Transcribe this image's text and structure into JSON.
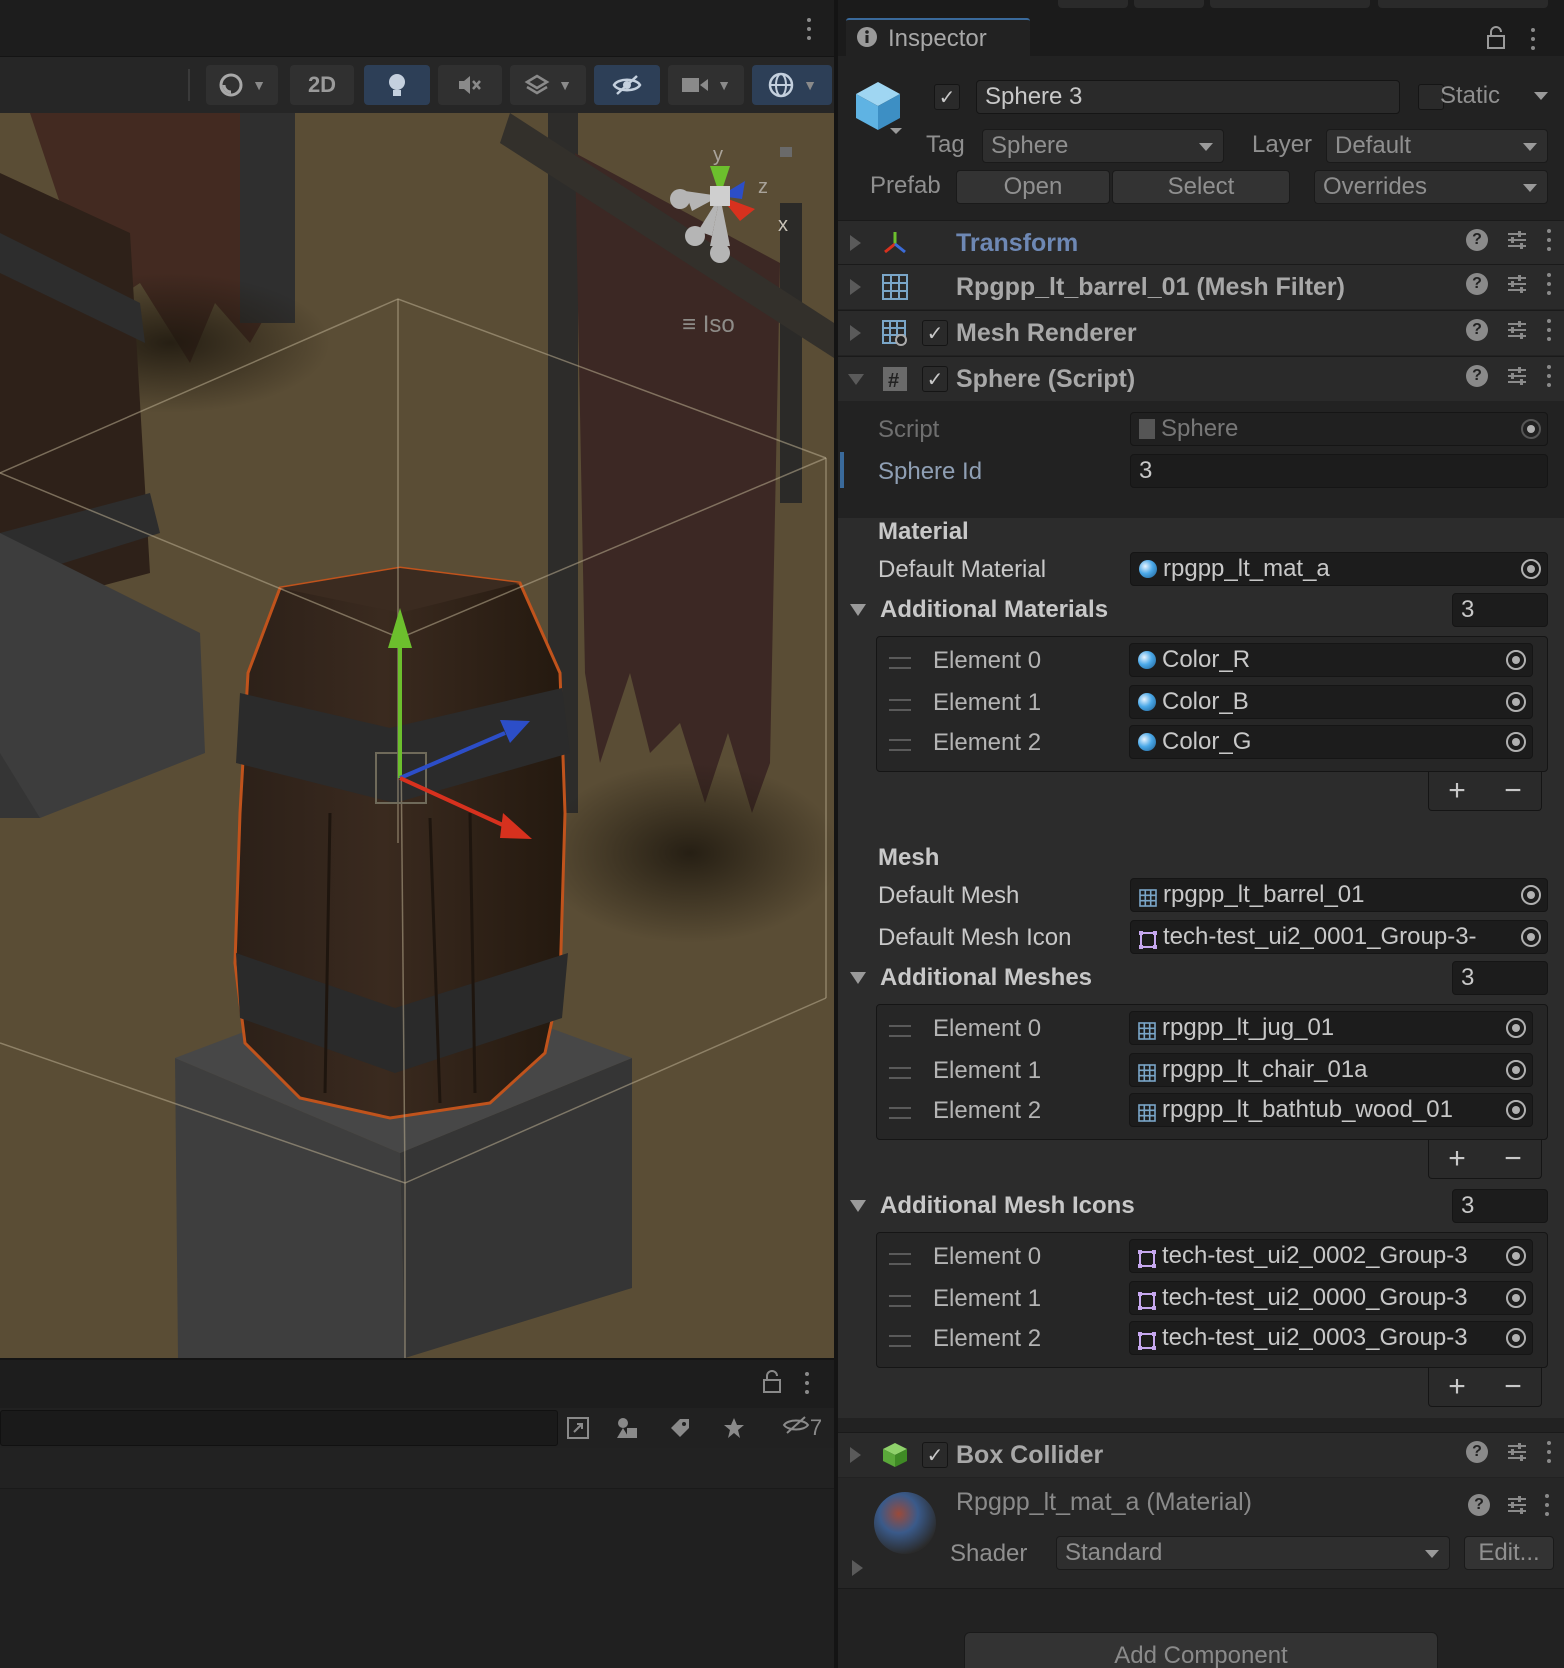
{
  "scene": {
    "toolbar": {
      "mode_2d": "2D"
    },
    "gizmo": {
      "x": "x",
      "y": "y",
      "z": "z"
    },
    "projection": "Iso",
    "bottom": {
      "hidden_count": "7"
    }
  },
  "inspector": {
    "tab_title": "Inspector",
    "object": {
      "name": "Sphere 3",
      "static_label": "Static",
      "tag_label": "Tag",
      "tag_value": "Sphere",
      "layer_label": "Layer",
      "layer_value": "Default",
      "prefab_label": "Prefab",
      "prefab_open": "Open",
      "prefab_select": "Select",
      "prefab_overrides": "Overrides"
    },
    "components": {
      "transform": "Transform",
      "mesh_filter": "Rpgpp_lt_barrel_01 (Mesh Filter)",
      "mesh_renderer": "Mesh Renderer",
      "sphere_script": "Sphere (Script)",
      "box_collider": "Box Collider"
    },
    "script_fields": {
      "script_label": "Script",
      "script_value": "Sphere",
      "sphere_id_label": "Sphere Id",
      "sphere_id_value": "3"
    },
    "material_section": {
      "header": "Material",
      "default_label": "Default Material",
      "default_value": "rpgpp_lt_mat_a",
      "additional_label": "Additional Materials",
      "count": "3",
      "elements": [
        {
          "label": "Element 0",
          "value": "Color_R"
        },
        {
          "label": "Element 1",
          "value": "Color_B"
        },
        {
          "label": "Element 2",
          "value": "Color_G"
        }
      ]
    },
    "mesh_section": {
      "header": "Mesh",
      "default_mesh_label": "Default Mesh",
      "default_mesh_value": "rpgpp_lt_barrel_01",
      "default_icon_label": "Default Mesh Icon",
      "default_icon_value": "tech-test_ui2_0001_Group-3-",
      "additional_meshes_label": "Additional Meshes",
      "meshes_count": "3",
      "meshes": [
        {
          "label": "Element 0",
          "value": "rpgpp_lt_jug_01"
        },
        {
          "label": "Element 1",
          "value": "rpgpp_lt_chair_01a"
        },
        {
          "label": "Element 2",
          "value": "rpgpp_lt_bathtub_wood_01"
        }
      ],
      "additional_icons_label": "Additional Mesh Icons",
      "icons_count": "3",
      "icons": [
        {
          "label": "Element 0",
          "value": "tech-test_ui2_0002_Group-3"
        },
        {
          "label": "Element 1",
          "value": "tech-test_ui2_0000_Group-3"
        },
        {
          "label": "Element 2",
          "value": "tech-test_ui2_0003_Group-3"
        }
      ]
    },
    "material_asset": {
      "title": "Rpgpp_lt_mat_a (Material)",
      "shader_label": "Shader",
      "shader_value": "Standard",
      "edit_label": "Edit..."
    },
    "add_component": "Add Component",
    "list_plus": "+",
    "list_minus": "−"
  },
  "colors": {
    "accent": "#2d3f57",
    "link": "#6e88b4",
    "selection_outline": "#c0531c"
  }
}
